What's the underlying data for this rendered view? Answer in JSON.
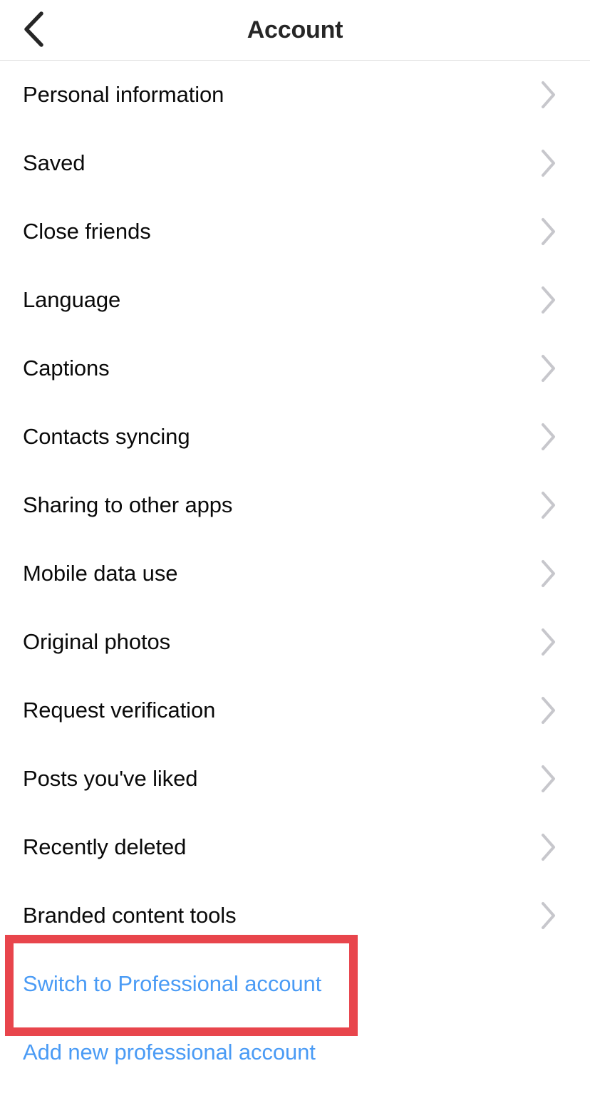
{
  "header": {
    "title": "Account",
    "back_icon": "chevron-left-icon"
  },
  "list": {
    "chevron_icon": "chevron-right-icon",
    "items": [
      {
        "label": "Personal information"
      },
      {
        "label": "Saved"
      },
      {
        "label": "Close friends"
      },
      {
        "label": "Language"
      },
      {
        "label": "Captions"
      },
      {
        "label": "Contacts syncing"
      },
      {
        "label": "Sharing to other apps"
      },
      {
        "label": "Mobile data use"
      },
      {
        "label": "Original photos"
      },
      {
        "label": "Request verification"
      },
      {
        "label": "Posts you've liked"
      },
      {
        "label": "Recently deleted"
      },
      {
        "label": "Branded content tools"
      }
    ]
  },
  "actions": [
    {
      "label": "Switch to Professional account"
    },
    {
      "label": "Add new professional account"
    }
  ],
  "annotation": {
    "target": "Switch to Professional account",
    "color": "#e8454c"
  },
  "colors": {
    "link_blue": "#4a9bf5",
    "text_primary": "#0a0a0a",
    "title": "#262626",
    "chevron_gray": "#c7c7cc",
    "separator": "#dbdbdb",
    "background": "#ffffff",
    "annotation_red": "#e8454c"
  }
}
